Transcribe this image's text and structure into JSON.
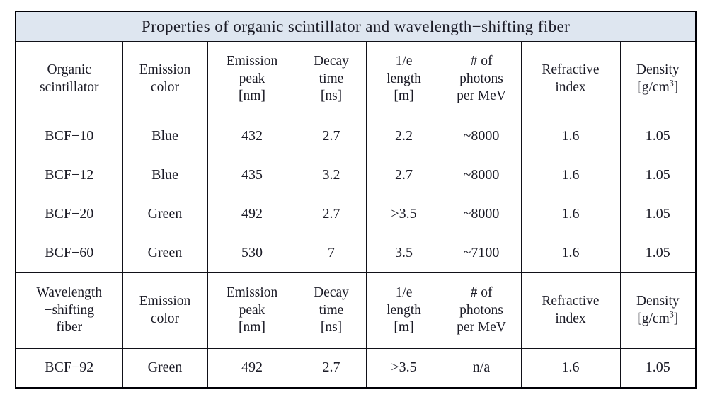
{
  "table": {
    "title": "Properties of organic scintillator and wavelength−shifting fiber",
    "header_scintillator": {
      "col0": {
        "line1": "Organic",
        "line2": "scintillator"
      },
      "col1": {
        "line1": "Emission",
        "line2": "color"
      },
      "col2": {
        "line1": "Emission",
        "line2": "peak",
        "line3": "[nm]"
      },
      "col3": {
        "line1": "Decay",
        "line2": "time",
        "line3": "[ns]"
      },
      "col4": {
        "line1": "1/e",
        "line2": "length",
        "line3": "[m]"
      },
      "col5": {
        "line1": "# of",
        "line2": "photons",
        "line3": "per MeV"
      },
      "col6": {
        "line1": "Refractive",
        "line2": "index"
      },
      "col7": {
        "line1": "Density",
        "line2_pre": "[g/cm",
        "line2_sup": "3",
        "line2_post": "]"
      }
    },
    "header_fiber": {
      "col0": {
        "line1": "Wavelength",
        "line2": "−shifting",
        "line3": "fiber"
      },
      "col1": {
        "line1": "Emission",
        "line2": "color"
      },
      "col2": {
        "line1": "Emission",
        "line2": "peak",
        "line3": "[nm]"
      },
      "col3": {
        "line1": "Decay",
        "line2": "time",
        "line3": "[ns]"
      },
      "col4": {
        "line1": "1/e",
        "line2": "length",
        "line3": "[m]"
      },
      "col5": {
        "line1": "# of",
        "line2": "photons",
        "line3": "per MeV"
      },
      "col6": {
        "line1": "Refractive",
        "line2": "index"
      },
      "col7": {
        "line1": "Density",
        "line2_pre": "[g/cm",
        "line2_sup": "3",
        "line2_post": "]"
      }
    },
    "scintillator_rows": [
      {
        "name": "BCF−10",
        "color": "Blue",
        "peak": "432",
        "decay": "2.7",
        "length": "2.2",
        "photons": "~8000",
        "index": "1.6",
        "density": "1.05"
      },
      {
        "name": "BCF−12",
        "color": "Blue",
        "peak": "435",
        "decay": "3.2",
        "length": "2.7",
        "photons": "~8000",
        "index": "1.6",
        "density": "1.05"
      },
      {
        "name": "BCF−20",
        "color": "Green",
        "peak": "492",
        "decay": "2.7",
        "length": ">3.5",
        "photons": "~8000",
        "index": "1.6",
        "density": "1.05"
      },
      {
        "name": "BCF−60",
        "color": "Green",
        "peak": "530",
        "decay": "7",
        "length": "3.5",
        "photons": "~7100",
        "index": "1.6",
        "density": "1.05"
      }
    ],
    "fiber_rows": [
      {
        "name": "BCF−92",
        "color": "Green",
        "peak": "492",
        "decay": "2.7",
        "length": ">3.5",
        "photons": "n/a",
        "index": "1.6",
        "density": "1.05"
      }
    ],
    "colors": {
      "title_background": "#dee6f0",
      "border": "#111118",
      "text": "#1b1b26",
      "page_background": "#ffffff"
    }
  }
}
